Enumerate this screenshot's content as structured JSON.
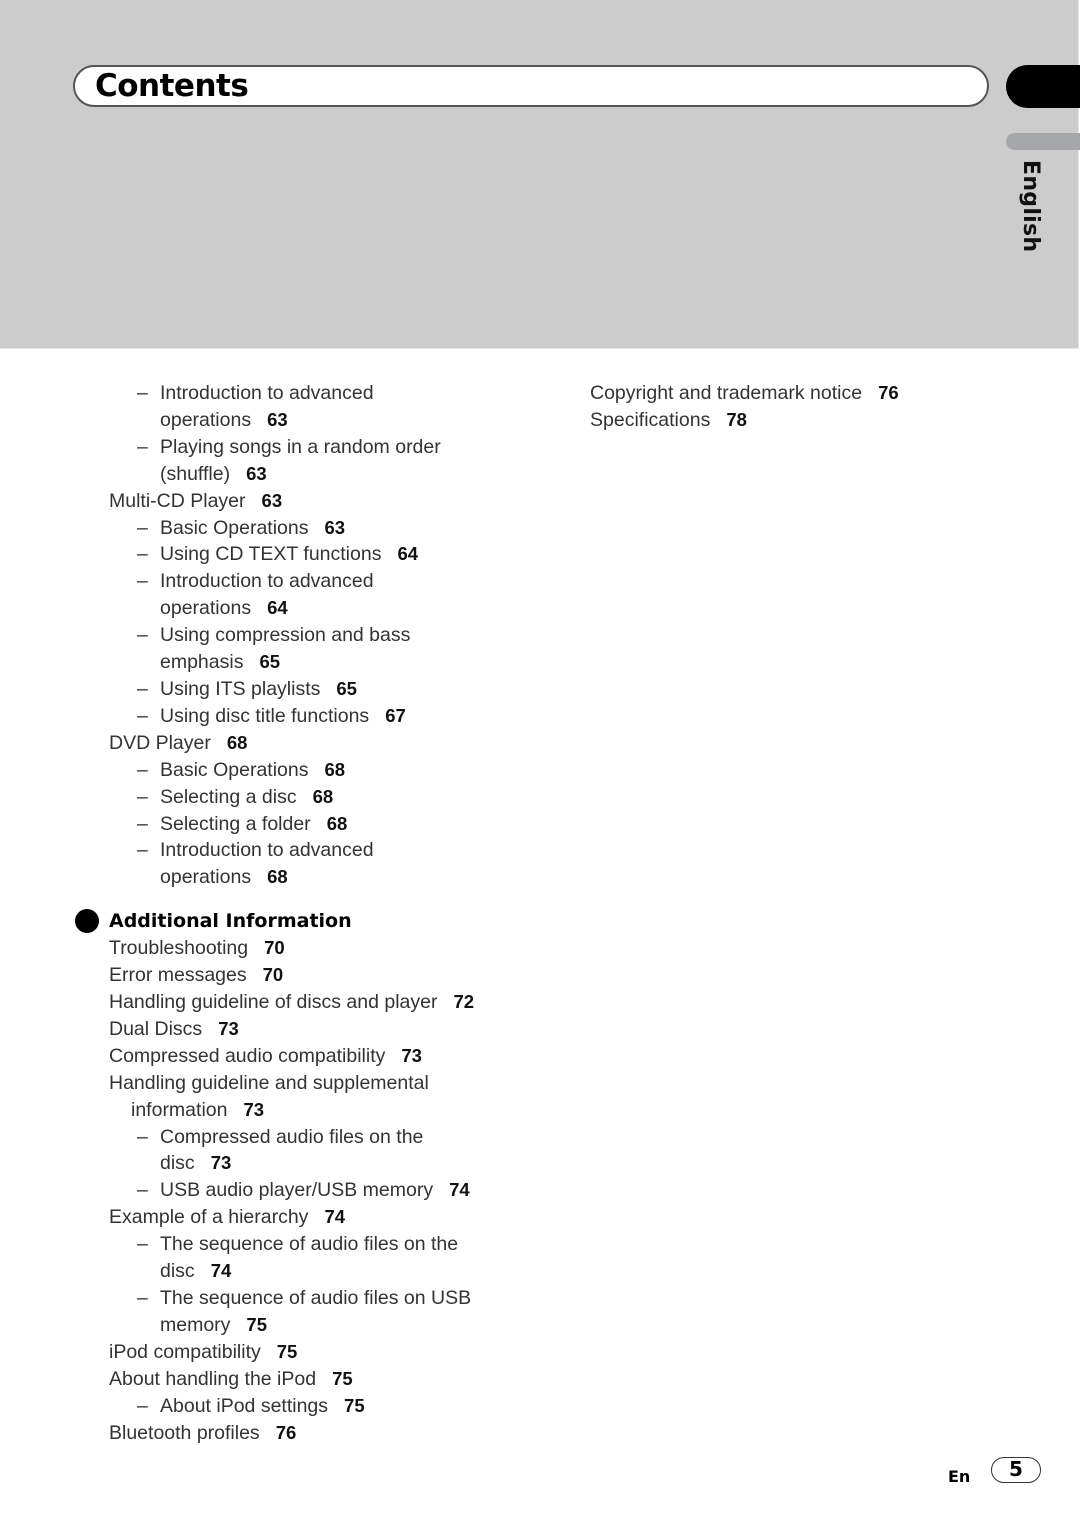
{
  "header": {
    "title": "Contents",
    "language_tab": "English"
  },
  "column1": {
    "before_section": [
      {
        "level": 1,
        "lines": [
          "Introduction to advanced",
          "operations"
        ],
        "page": "63"
      },
      {
        "level": 1,
        "lines": [
          "Playing songs in a random order",
          "(shuffle)"
        ],
        "page": "63"
      },
      {
        "level": 0,
        "lines": [
          "Multi-CD Player"
        ],
        "page": "63"
      },
      {
        "level": 1,
        "lines": [
          "Basic Operations"
        ],
        "page": "63"
      },
      {
        "level": 1,
        "lines": [
          "Using CD TEXT functions"
        ],
        "page": "64"
      },
      {
        "level": 1,
        "lines": [
          "Introduction to advanced",
          "operations"
        ],
        "page": "64"
      },
      {
        "level": 1,
        "lines": [
          "Using compression and bass",
          "emphasis"
        ],
        "page": "65"
      },
      {
        "level": 1,
        "lines": [
          "Using ITS playlists"
        ],
        "page": "65"
      },
      {
        "level": 1,
        "lines": [
          "Using disc title functions"
        ],
        "page": "67"
      },
      {
        "level": 0,
        "lines": [
          "DVD Player"
        ],
        "page": "68"
      },
      {
        "level": 1,
        "lines": [
          "Basic Operations"
        ],
        "page": "68"
      },
      {
        "level": 1,
        "lines": [
          "Selecting a disc"
        ],
        "page": "68"
      },
      {
        "level": 1,
        "lines": [
          "Selecting a folder"
        ],
        "page": "68"
      },
      {
        "level": 1,
        "lines": [
          "Introduction to advanced",
          "operations"
        ],
        "page": "68"
      }
    ],
    "section_title": "Additional Information",
    "after_section": [
      {
        "level": 0,
        "lines": [
          "Troubleshooting"
        ],
        "page": "70"
      },
      {
        "level": 0,
        "lines": [
          "Error messages"
        ],
        "page": "70"
      },
      {
        "level": 0,
        "lines": [
          "Handling guideline of discs and player"
        ],
        "page": "72"
      },
      {
        "level": 0,
        "lines": [
          "Dual Discs"
        ],
        "page": "73"
      },
      {
        "level": 0,
        "lines": [
          "Compressed audio compatibility"
        ],
        "page": "73"
      },
      {
        "level": 0,
        "lines": [
          "Handling guideline and supplemental",
          "information"
        ],
        "page": "73"
      },
      {
        "level": 1,
        "lines": [
          "Compressed audio files on the",
          "disc"
        ],
        "page": "73"
      },
      {
        "level": 1,
        "lines": [
          "USB audio player/USB memory"
        ],
        "page": "74"
      },
      {
        "level": 0,
        "lines": [
          "Example of a hierarchy"
        ],
        "page": "74"
      },
      {
        "level": 1,
        "lines": [
          "The sequence of audio files on the",
          "disc"
        ],
        "page": "74"
      },
      {
        "level": 1,
        "lines": [
          "The sequence of audio files on USB",
          "memory"
        ],
        "page": "75"
      },
      {
        "level": 0,
        "lines": [
          "iPod compatibility"
        ],
        "page": "75"
      },
      {
        "level": 0,
        "lines": [
          "About handling the iPod"
        ],
        "page": "75"
      },
      {
        "level": 1,
        "lines": [
          "About iPod settings"
        ],
        "page": "75"
      },
      {
        "level": 0,
        "lines": [
          "Bluetooth profiles"
        ],
        "page": "76"
      }
    ]
  },
  "column2": [
    {
      "level": 0,
      "lines": [
        "Copyright and trademark notice"
      ],
      "page": "76"
    },
    {
      "level": 0,
      "lines": [
        "Specifications"
      ],
      "page": "78"
    }
  ],
  "footer": {
    "lang_code": "En",
    "page_number": "5"
  }
}
